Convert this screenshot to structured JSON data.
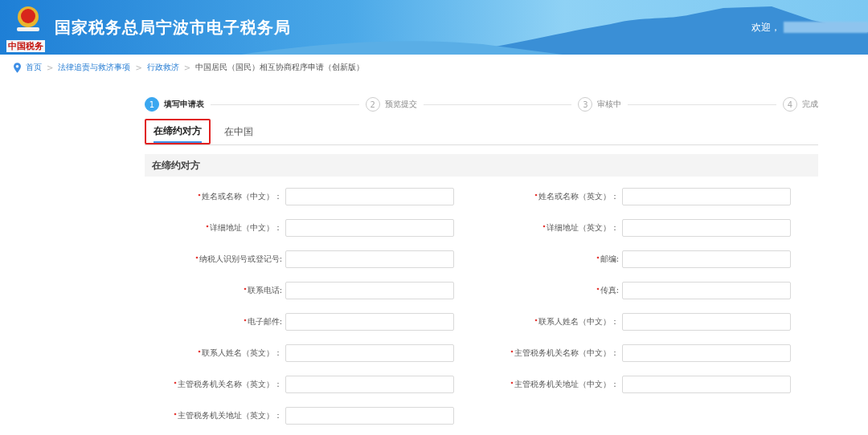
{
  "header": {
    "title": "国家税务总局宁波市电子税务局",
    "logo_caption": "中国税务",
    "welcome": "欢迎，"
  },
  "breadcrumb": [
    {
      "label": "首页",
      "link": true
    },
    {
      "label": "法律追责与救济事项",
      "link": true
    },
    {
      "label": "行政救济",
      "link": true
    },
    {
      "label": "中国居民（国民）相互协商程序申请（创新版）",
      "link": false
    }
  ],
  "breadcrumb_separator": ">",
  "steps": [
    {
      "number": "1",
      "label": "填写申请表",
      "selected": true
    },
    {
      "number": "2",
      "label": "预览提交",
      "selected": false
    },
    {
      "number": "3",
      "label": "审核中",
      "selected": false
    },
    {
      "number": "4",
      "label": "完成",
      "selected": false
    }
  ],
  "tabs": [
    {
      "label": "在缔约对方",
      "selected": true,
      "highlighted": true
    },
    {
      "label": "在中国",
      "selected": false,
      "highlighted": false
    }
  ],
  "section_title": "在缔约对方",
  "fields": [
    {
      "label": "姓名或名称（中文）：",
      "required": true
    },
    {
      "label": "姓名或名称（英文）：",
      "required": true
    },
    {
      "label": "详细地址（中文）：",
      "required": true
    },
    {
      "label": "详细地址（英文）：",
      "required": true
    },
    {
      "label": "纳税人识别号或登记号:",
      "required": true
    },
    {
      "label": "邮编:",
      "required": true
    },
    {
      "label": "联系电话:",
      "required": true
    },
    {
      "label": "传真:",
      "required": true
    },
    {
      "label": "电子邮件:",
      "required": true
    },
    {
      "label": "联系人姓名（中文）：",
      "required": true
    },
    {
      "label": "联系人姓名（英文）：",
      "required": true
    },
    {
      "label": "主管税务机关名称（中文）：",
      "required": true
    },
    {
      "label": "主管税务机关名称（英文）：",
      "required": true
    },
    {
      "label": "主管税务机关地址（中文）：",
      "required": true
    },
    {
      "label": "主管税务机关地址（英文）：",
      "required": true
    }
  ]
}
